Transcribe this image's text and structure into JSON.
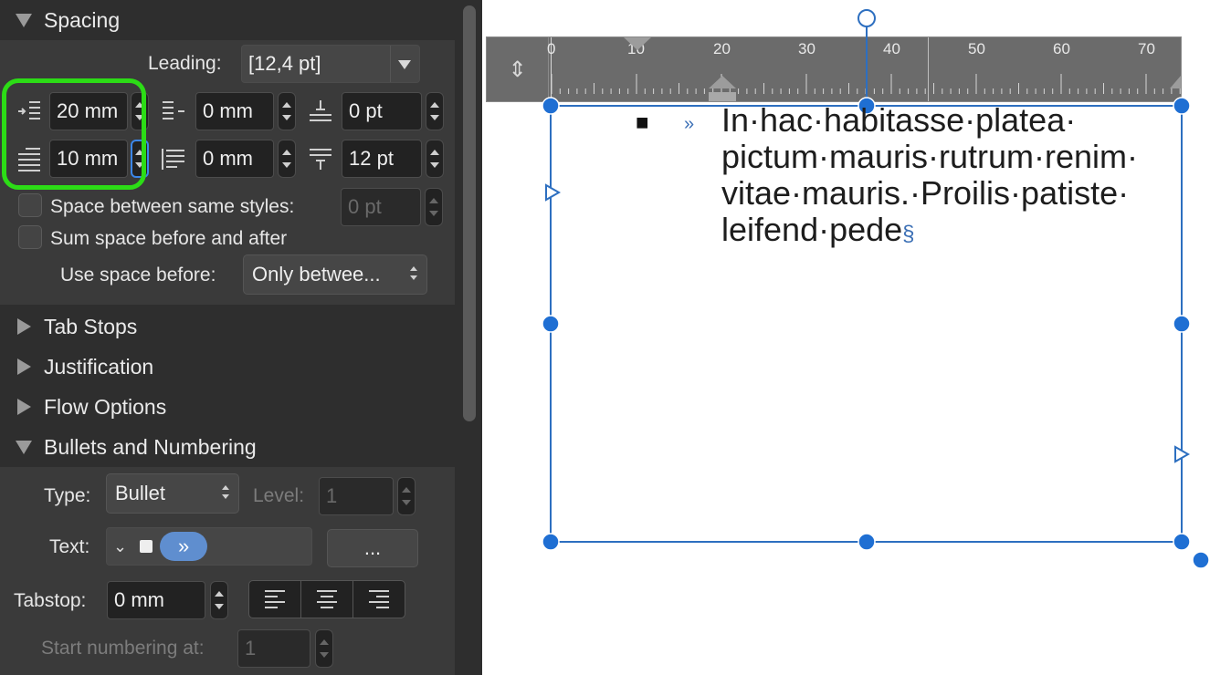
{
  "panel": {
    "sections": {
      "spacing": "Spacing",
      "tab_stops": "Tab Stops",
      "justification": "Justification",
      "flow_options": "Flow Options",
      "bullets": "Bullets and Numbering"
    },
    "spacing": {
      "leading_label": "Leading:",
      "leading_value": "[12,4 pt]",
      "left_indent": "20 mm",
      "right_indent": "0 mm",
      "space_after": "0 pt",
      "first_line_indent": "10 mm",
      "last_line_indent": "0 mm",
      "space_before": "12 pt",
      "same_styles_label": "Space between same styles:",
      "same_styles_value": "0 pt",
      "sum_space_label": "Sum space before and after",
      "use_space_label": "Use space before:",
      "use_space_value": "Only betwee..."
    },
    "bullets": {
      "type_label": "Type:",
      "type_value": "Bullet",
      "level_label": "Level:",
      "level_value": "1",
      "text_label": "Text:",
      "text_chevron": "⌄",
      "text_chip": "»",
      "more_button": "...",
      "tabstop_label": "Tabstop:",
      "tabstop_value": "0 mm",
      "start_label": "Start numbering at:",
      "start_value": "1"
    }
  },
  "canvas": {
    "ruler_numbers": [
      "0",
      "10",
      "20",
      "30",
      "40",
      "50",
      "60",
      "70"
    ],
    "bullet_glyph": "■",
    "tab_marker": "»",
    "text_lines": [
      "In·hac·habitasse·platea·",
      "pictum·mauris·rutrum·renim·",
      "vitae·mauris.·Proilis·patiste·",
      "leifend·pede"
    ],
    "pilcrow": "§"
  },
  "colors": {
    "panel_bg": "#2e2e2e",
    "section_bg": "#3a3a3a",
    "highlight": "#2cdc16",
    "selection_blue": "#2d6fc0",
    "chip_blue": "#5f8ecf"
  }
}
